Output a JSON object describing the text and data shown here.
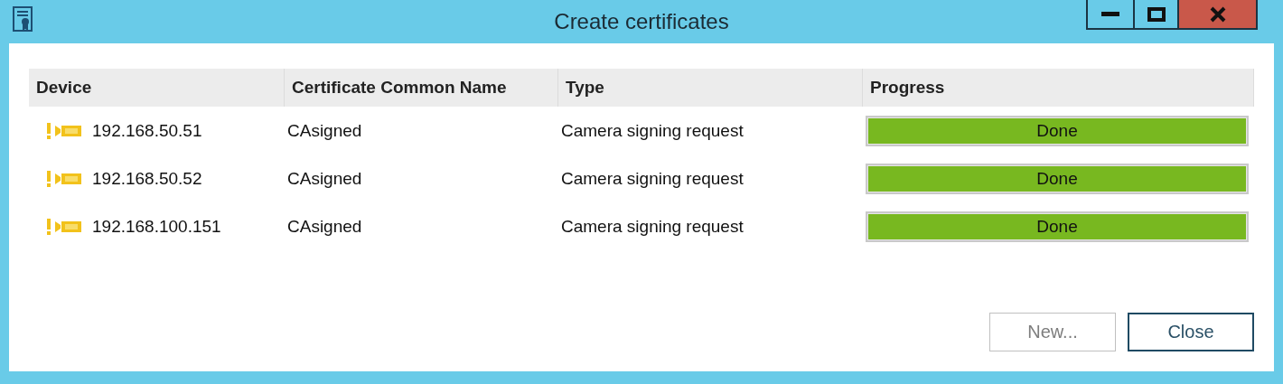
{
  "window": {
    "title": "Create certificates"
  },
  "table": {
    "columns": [
      "Device",
      "Certificate Common Name",
      "Type",
      "Progress"
    ],
    "rows": [
      {
        "device": "192.168.50.51",
        "common_name": "CAsigned",
        "type": "Camera signing request",
        "level": 1,
        "progress_label": "Done"
      },
      {
        "device": "192.168.50.52",
        "common_name": "CAsigned",
        "type": "Camera signing request",
        "level": 1,
        "progress_label": "Done"
      },
      {
        "device": "192.168.100.151",
        "common_name": "CAsigned",
        "type": "Camera signing request",
        "level": 1,
        "progress_label": "Done"
      }
    ]
  },
  "buttons": [
    {
      "label": "New...",
      "disabled": true
    },
    {
      "label": "Close",
      "disabled": false
    }
  ]
}
